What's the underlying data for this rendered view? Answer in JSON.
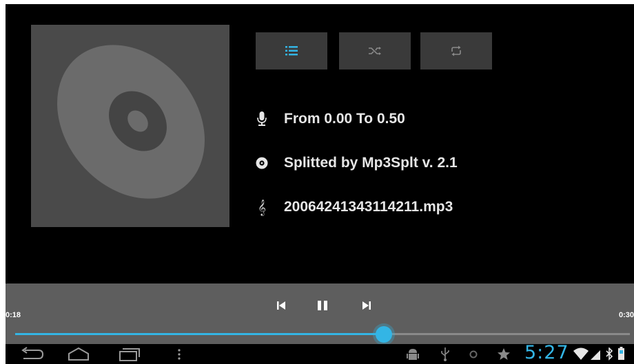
{
  "colors": {
    "accent": "#33b5e5",
    "background": "#000000",
    "album_bg": "#4a4a4a",
    "player_bar": "#5e5e5e"
  },
  "controls": [
    {
      "name": "playlist",
      "icon": "list-icon",
      "active": true
    },
    {
      "name": "shuffle",
      "icon": "shuffle-icon",
      "active": false
    },
    {
      "name": "repeat",
      "icon": "repeat-icon",
      "active": false
    }
  ],
  "track_info": {
    "range": "From 0.00 To 0.50",
    "artist": "Splitted by Mp3Splt v. 2.1",
    "title": "20064241343114211.mp3"
  },
  "player": {
    "elapsed": "0:18",
    "duration": "0:30",
    "progress": 0.6
  },
  "status_bar": {
    "time": "5:27"
  }
}
